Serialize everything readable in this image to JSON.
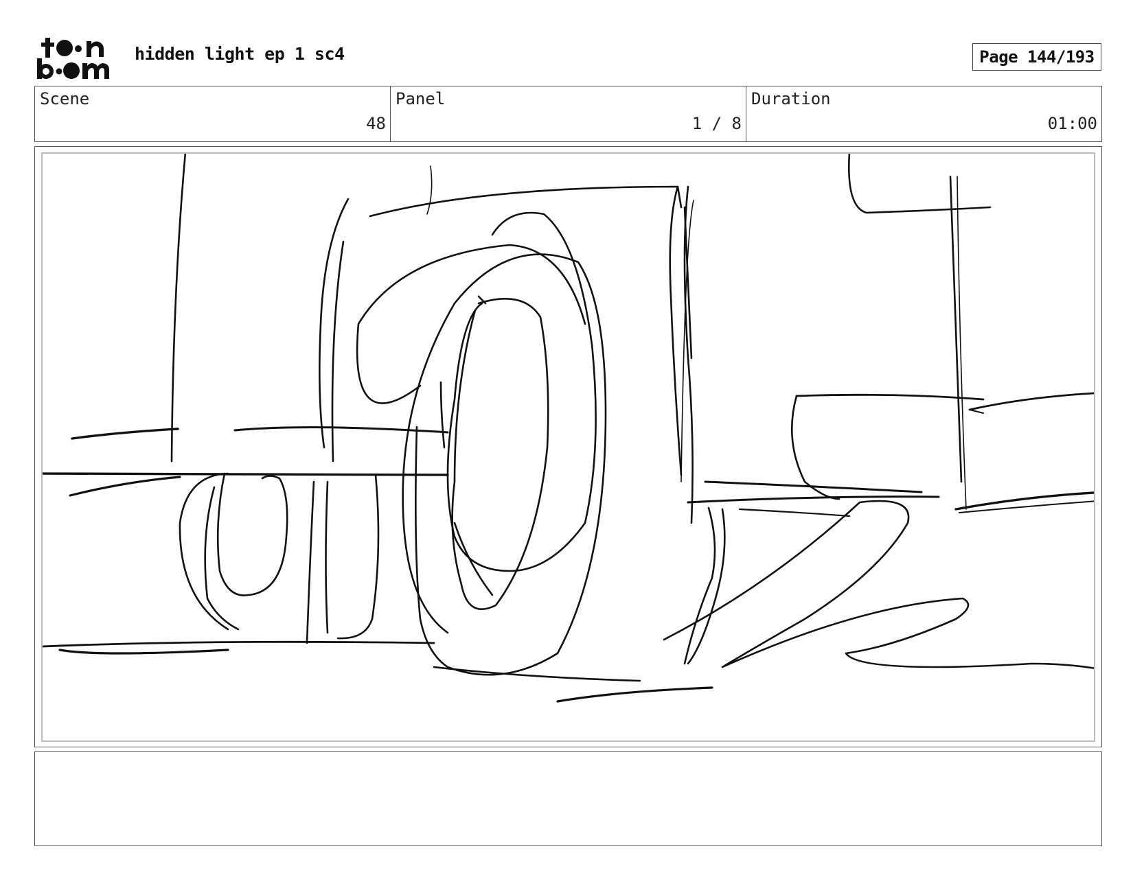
{
  "header": {
    "logo_text_top": "toon",
    "logo_text_bottom": "boom",
    "project_title": "hidden light ep 1 sc4",
    "page_label": "Page 144/193"
  },
  "info": {
    "scene_label": "Scene",
    "scene_value": "48",
    "panel_label": "Panel",
    "panel_value": "1 / 8",
    "duration_label": "Duration",
    "duration_value": "01:00"
  },
  "panel": {
    "image_description_icon": "sketch-truck-wheels",
    "stroke_color": "#111111"
  },
  "notes": {
    "text": ""
  }
}
